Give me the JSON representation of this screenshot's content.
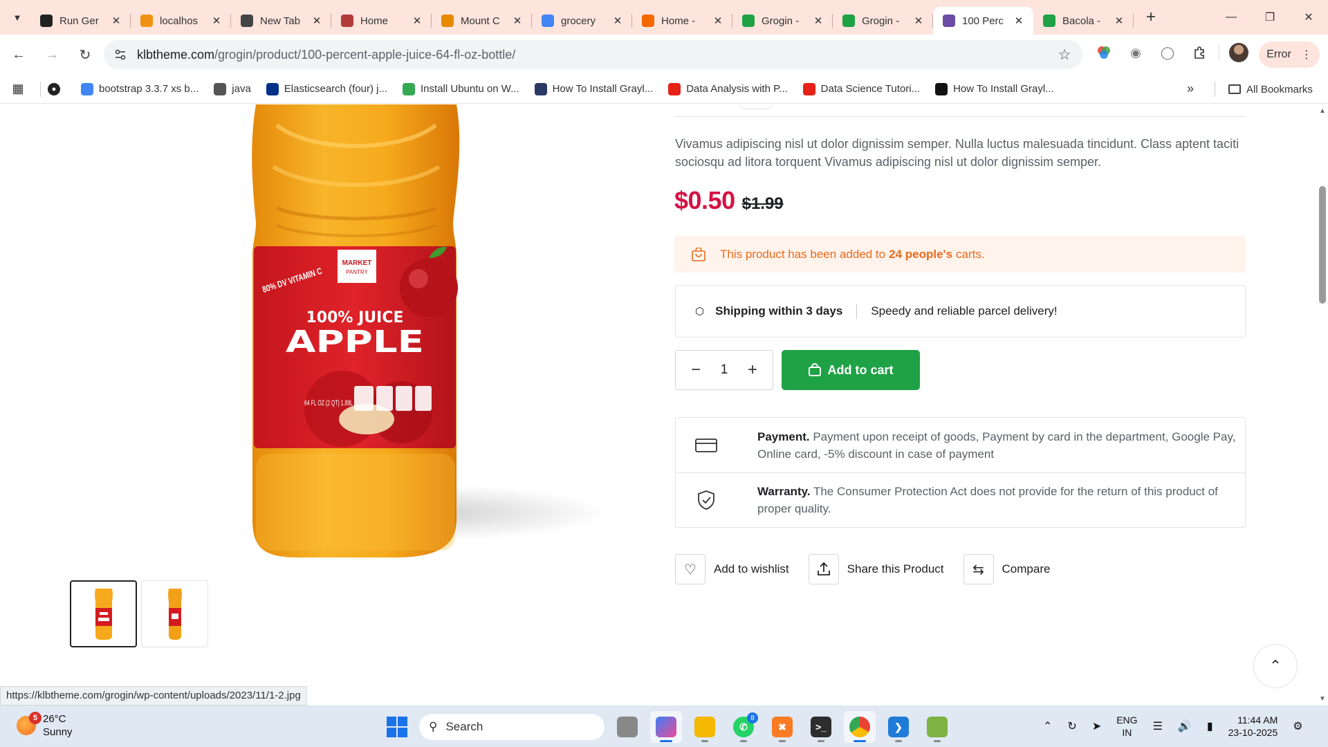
{
  "tabs": [
    {
      "title": "Run Ger",
      "icon": "openai-icon",
      "color": "#222222"
    },
    {
      "title": "localhos",
      "icon": "phpmyadmin-icon",
      "color": "#f29111"
    },
    {
      "title": "New Tab",
      "icon": "chrome-icon",
      "color": "#444444"
    },
    {
      "title": "Home",
      "icon": "scribe-icon",
      "color": "#b33a3a"
    },
    {
      "title": "Mount C",
      "icon": "aws-icon",
      "color": "#e68a00"
    },
    {
      "title": "grocery",
      "icon": "google-icon",
      "color": "#4285f4"
    },
    {
      "title": "Home -",
      "icon": "grafana-icon",
      "color": "#f46800"
    },
    {
      "title": "Grogin -",
      "icon": "grogin-icon",
      "color": "#1fa246"
    },
    {
      "title": "Grogin -",
      "icon": "grogin-icon",
      "color": "#1fa246"
    },
    {
      "title": "100 Perc",
      "icon": "cart-icon",
      "color": "#6b4ba6",
      "active": true
    },
    {
      "title": "Bacola -",
      "icon": "bacola-icon",
      "color": "#1fa246"
    }
  ],
  "toolbar": {
    "url_host": "klbtheme.com",
    "url_path": "/grogin/product/100-percent-apple-juice-64-fl-oz-bottle/",
    "error_label": "Error"
  },
  "bookmarks": [
    {
      "label": "bootstrap 3.3.7 xs b...",
      "icon": "google-icon",
      "color": "#4285f4"
    },
    {
      "label": "java",
      "icon": "folder-icon",
      "color": "#555555"
    },
    {
      "label": "Elasticsearch (four) j...",
      "icon": "paypal-icon",
      "color": "#003087"
    },
    {
      "label": "Install Ubuntu on W...",
      "icon": "drive-icon",
      "color": "#34a853"
    },
    {
      "label": "How To Install Grayl...",
      "icon": "graylog-icon",
      "color": "#2b3a67"
    },
    {
      "label": "Data Analysis with P...",
      "icon": "youtube-icon",
      "color": "#e62117"
    },
    {
      "label": "Data Science Tutori...",
      "icon": "youtube-icon",
      "color": "#e62117"
    },
    {
      "label": "How To Install Grayl...",
      "icon": "terminal-icon",
      "color": "#111111"
    }
  ],
  "all_bookmarks_label": "All Bookmarks",
  "product": {
    "description": "Vivamus adipiscing nisl ut dolor dignissim semper. Nulla luctus malesuada tincidunt. Class aptent taciti sociosqu ad litora torquent Vivamus adipiscing nisl ut dolor dignissim semper.",
    "price_new": "$0.50",
    "price_old": "$1.99",
    "cart_notice_before": "This product has been added to",
    "cart_notice_count": "24 people's",
    "cart_notice_after": "carts.",
    "shipping_title": "Shipping within 3 days",
    "shipping_desc": "Speedy and reliable parcel delivery!",
    "quantity": "1",
    "add_to_cart": "Add to cart",
    "payment_title": "Payment.",
    "payment_text": "Payment upon receipt of goods, Payment by card in the department, Google Pay, Online card, -5% discount in case of payment",
    "warranty_title": "Warranty.",
    "warranty_text": "The Consumer Protection Act does not provide for the return of this product of proper quality.",
    "wishlist": "Add to wishlist",
    "share": "Share this Product",
    "compare": "Compare"
  },
  "label_art": {
    "brand_line1": "MARKET",
    "brand_line2": "PANTRY",
    "vitamin": "80% DV VITAMIN C",
    "line1": "100% JUICE",
    "line2": "APPLE",
    "size": "64 FL OZ (2 QT) 1.89L"
  },
  "status_url": "https://klbtheme.com/grogin/wp-content/uploads/2023/11/1-2.jpg",
  "taskbar": {
    "temperature": "26°C",
    "condition": "Sunny",
    "weather_badge": "5",
    "search_placeholder": "Search",
    "whatsapp_count": "8",
    "lang_line1": "ENG",
    "lang_line2": "IN",
    "time": "11:44 AM",
    "date": "23-10-2025"
  }
}
